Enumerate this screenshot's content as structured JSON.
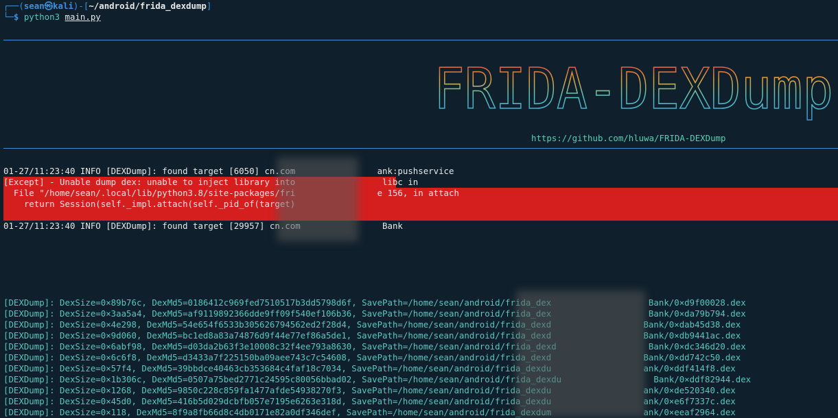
{
  "prompt": {
    "user": "sean",
    "host": "kali",
    "separator": "㉿",
    "cwd": "~/android/frida_dexdump",
    "command_prog": "python3",
    "command_arg": "main.py"
  },
  "banner": {
    "ascii_lines": [
      " ________  _______   ___   _______     ______        ________  _______  ___  ___  ",
      "|_   __  ||_   __ \\ |_  | |_   __ \\   |_   _ `.     |_   _ `.|_   __ ||_  ||_  _| ",
      "  | |_ \\_|  | |__) |  | |   | |  \\ \\    | | `. \\ ____ | | `. \\ | |_ \\_|  \\ \\/ /   _   _   _ __   _ __   ",
      "  |  _|     |  __ /   | |   | |   | |   | |  | ||____|| |  | | |  _| _   > <   | | | | | '_ ` _ \\| '_ \\ ",
      " _| |_     _| |  \\ \\_ | |  _| |__/ |  _| |_.' /      _| |_.' /_| |__/ |_/ /\\ \\_ | |_| | | | | | | |_) |",
      "|_____|   |____| |___||___||_______/  |______.'      |______.'|________||____||____| \\__,_|_| |_| |_| .__/ ",
      "                                                                                                    |_|    "
    ],
    "url": "https://github.com/hluwa/FRIDA-DEXDump"
  },
  "log": {
    "found1": "01-27/11:23:40 INFO [DEXDump]: found target [6050] cn.com                ank:pushservice",
    "except1": "[Except] - Unable dump dex: unable to inject library into                 libc in",
    "except2": "  File \"/home/sean/.local/lib/python3.8/site-packages/fri                e 156, in attach",
    "except3": "    return Session(self._impl.attach(self._pid_of(target)",
    "found2": "01-27/11:23:40 INFO [DEXDump]: found target [29957] cn.com                Bank"
  },
  "dumps": [
    "[DEXDump]: DexSize=0×89b76c, DexMd5=0186412c969fed7510517b3dd5798d6f, SavePath=/home/sean/android/frida_dex                   Bank/0×d9f00028.dex",
    "[DEXDump]: DexSize=0×3aa5a4, DexMd5=af9119892366dde9ff09f540ef106b36, SavePath=/home/sean/android/frida_dex                   Bank/0×da79b794.dex",
    "[DEXDump]: DexSize=0×4e298, DexMd5=54e654f6533b305626794562ed2f28d4, SavePath=/home/sean/android/frida_dexd                  Bank/0×dab45d38.dex",
    "[DEXDump]: DexSize=0×9d060, DexMd5=bc1ed8a83a74876d9f44e77ef86a5de1, SavePath=/home/sean/android/frida_dexd                  Bank/0×db9441ac.dex",
    "[DEXDump]: DexSize=0×6abf98, DexMd5=d03da2b63f3e10008c32f4ee793a8630, SavePath=/home/sean/android/frida_dexd                  Bank/0×dc346d20.dex",
    "[DEXDump]: DexSize=0×6c6f8, DexMd5=d3433a7f225150ba09aee743c7c54608, SavePath=/home/sean/android/frida_dexd                  Bank/0×dd742c50.dex",
    "[DEXDump]: DexSize=0×57f4, DexMd5=39bbdce40463cb353684c4faf18c7034, SavePath=/home/sean/android/frida_dexdu                  ank/0×ddf414f8.dex",
    "[DEXDump]: DexSize=0×1b306c, DexMd5=0507a75bed2771c24595c80056bbad02, SavePath=/home/sean/android/frida_dexdu                  Bank/0×ddf82944.dex",
    "[DEXDump]: DexSize=0×1268, DexMd5=9850c228c859fa1477afde54938270f3, SavePath=/home/sean/android/frida_dexdu                  ank/0×de520340.dex",
    "[DEXDump]: DexSize=0×45d0, DexMd5=416b5d029dcbfb057e7195e6263e318d, SavePath=/home/sean/android/frida_dexdu                  ank/0×e6f7337c.dex",
    "[DEXDump]: DexSize=0×118, DexMd5=8f9a8fb66d8c4db0171e82a0df346def, SavePath=/home/sean/android/frida_dexdum                  ank/0×eeaf2964.dex"
  ]
}
